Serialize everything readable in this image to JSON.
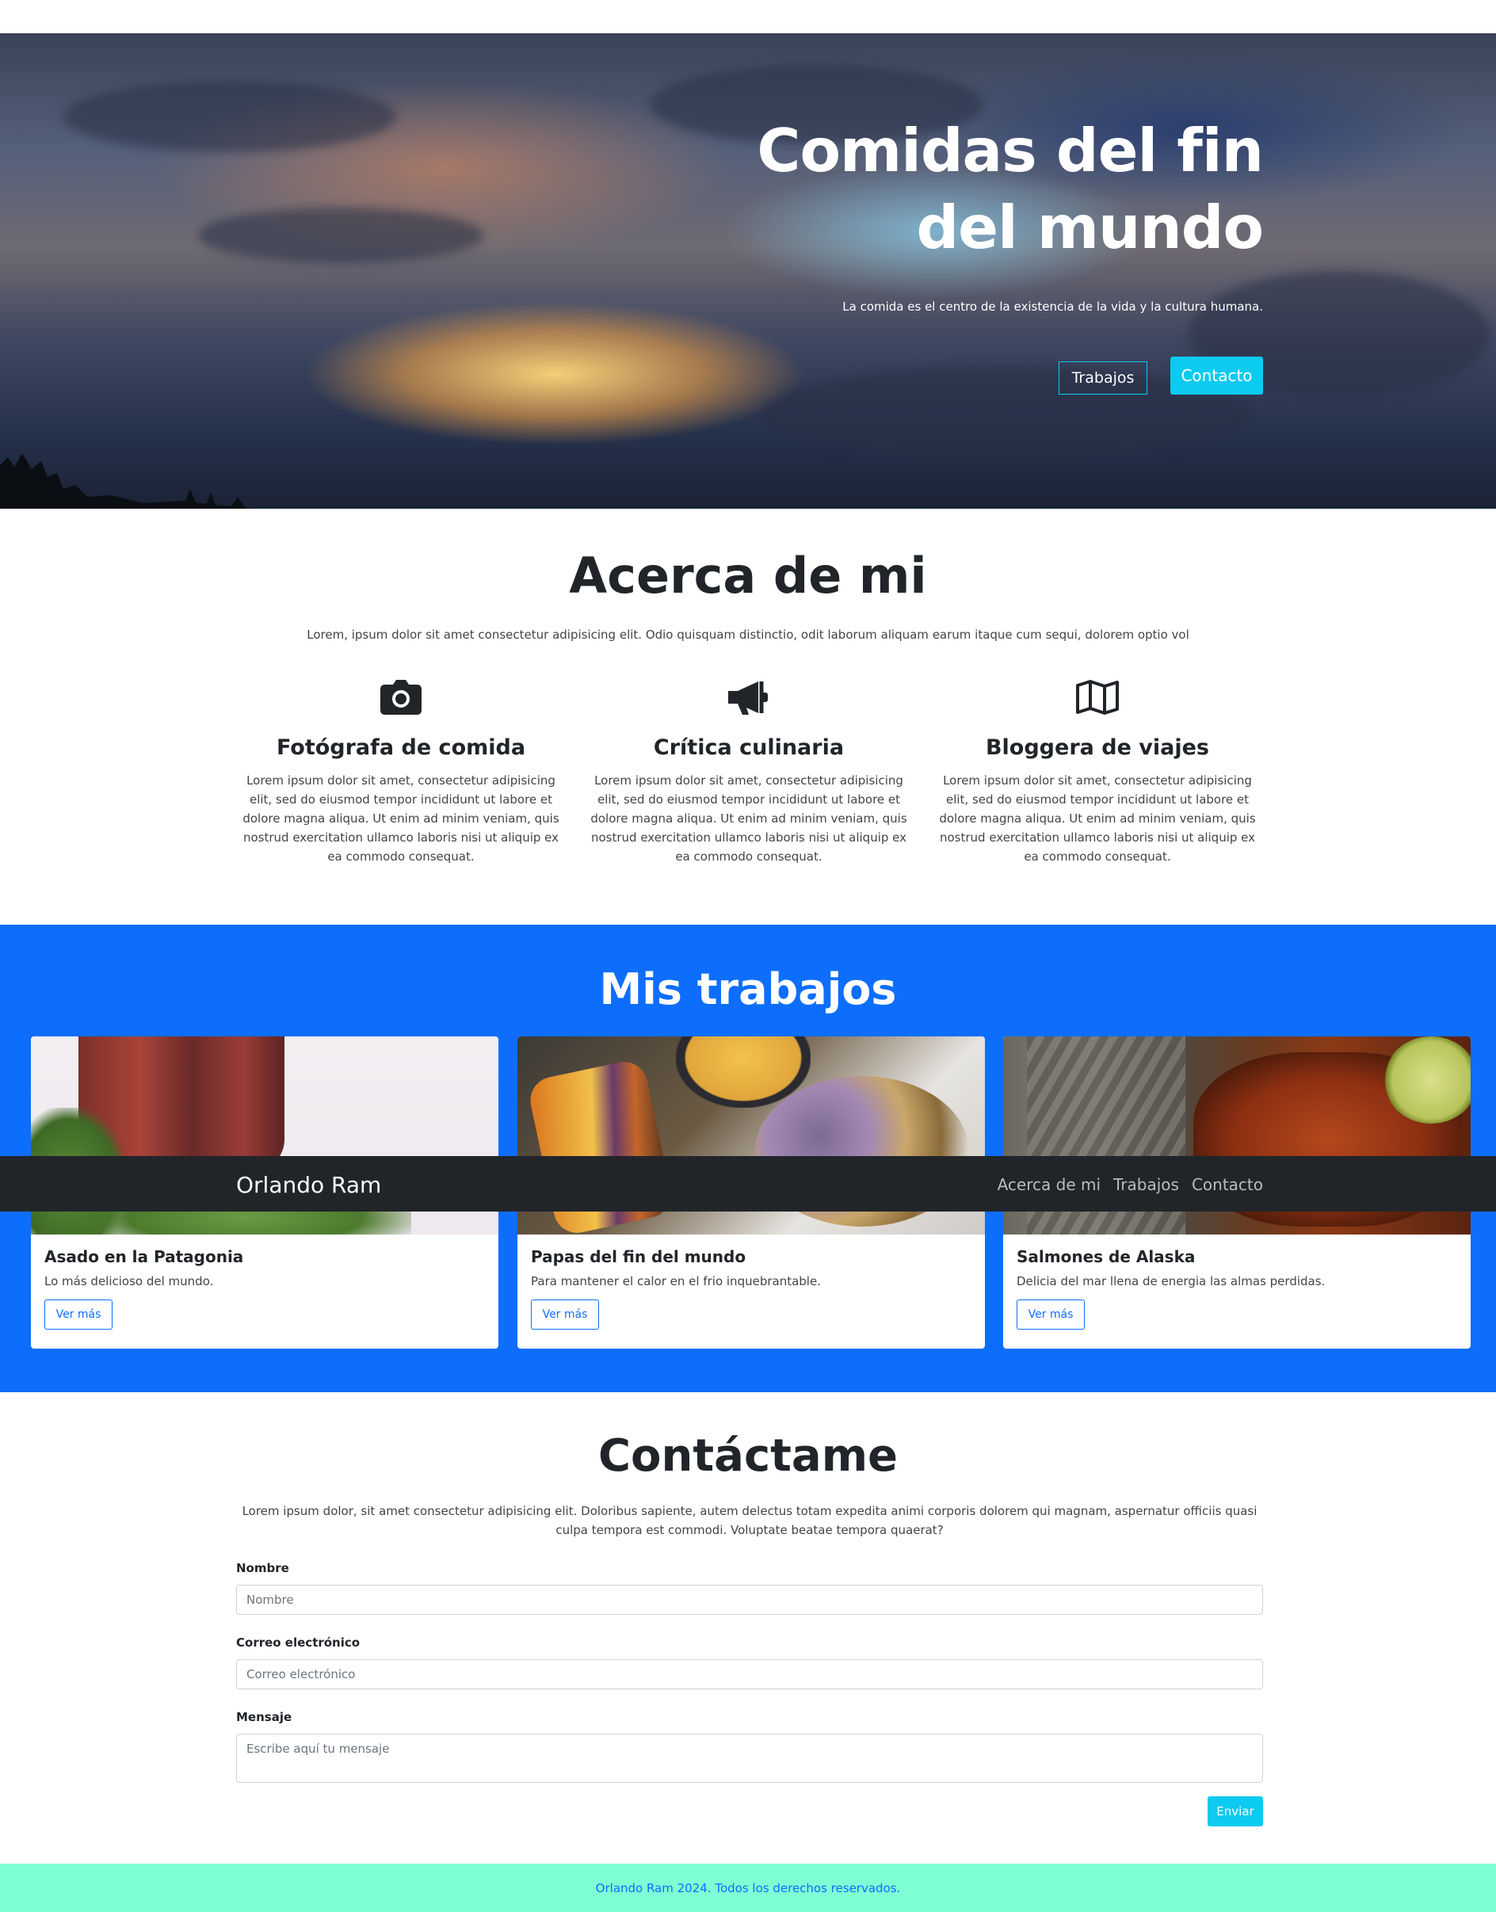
{
  "hero": {
    "title_line1": "Comidas del fin",
    "title_line2": "del mundo",
    "subtitle": "La comida es el centro de la existencia de la vida y la cultura humana.",
    "btn_works": "Trabajos",
    "btn_contact": "Contacto"
  },
  "about": {
    "title": "Acerca de mi",
    "lead": "Lorem, ipsum dolor sit amet consectetur adipisicing elit. Odio quisquam distinctio, odit laborum aliquam earum itaque cum sequi, dolorem optio vol",
    "columns": [
      {
        "icon": "camera-icon",
        "title": "Fotógrafa de comida",
        "text": "Lorem ipsum dolor sit amet, consectetur adipisicing elit, sed do eiusmod tempor incididunt ut labore et dolore magna aliqua. Ut enim ad minim veniam, quis nostrud exercitation ullamco laboris nisi ut aliquip ex ea commodo consequat."
      },
      {
        "icon": "megaphone-icon",
        "title": "Crítica culinaria",
        "text": "Lorem ipsum dolor sit amet, consectetur adipisicing elit, sed do eiusmod tempor incididunt ut labore et dolore magna aliqua. Ut enim ad minim veniam, quis nostrud exercitation ullamco laboris nisi ut aliquip ex ea commodo consequat."
      },
      {
        "icon": "map-icon",
        "title": "Bloggera de viajes",
        "text": "Lorem ipsum dolor sit amet, consectetur adipisicing elit, sed do eiusmod tempor incididunt ut labore et dolore magna aliqua. Ut enim ad minim veniam, quis nostrud exercitation ullamco laboris nisi ut aliquip ex ea commodo consequat."
      }
    ]
  },
  "works": {
    "title": "Mis trabajos",
    "cards": [
      {
        "title": "Asado en la Patagonia",
        "text": "Lo más delicioso del mundo.",
        "button": "Ver más"
      },
      {
        "title": "Papas del fin del mundo",
        "text": "Para mantener el calor en el frio inquebrantable.",
        "button": "Ver más"
      },
      {
        "title": "Salmones de Alaska",
        "text": "Delicia del mar llena de energia las almas perdidas.",
        "button": "Ver más"
      }
    ]
  },
  "navbar": {
    "brand": "Orlando Ram",
    "links": [
      "Acerca de mi",
      "Trabajos",
      "Contacto"
    ]
  },
  "contact": {
    "title": "Contáctame",
    "lead": "Lorem ipsum dolor, sit amet consectetur adipisicing elit. Doloribus sapiente, autem delectus totam expedita animi corporis dolorem qui magnam, aspernatur officiis quasi culpa tempora est commodi. Voluptate beatae tempora quaerat?",
    "name_label": "Nombre",
    "name_placeholder": "Nombre",
    "email_label": "Correo electrónico",
    "email_placeholder": "Correo electrónico",
    "message_label": "Mensaje",
    "message_placeholder": "Escribe aquí tu mensaje",
    "submit": "Enviar"
  },
  "footer": {
    "text": "Orlando Ram 2024. Todos los derechos reservados."
  },
  "colors": {
    "primary": "#0d6efd",
    "info": "#0dcaf0",
    "navbar": "#212529",
    "footer": "#7fffd4"
  }
}
